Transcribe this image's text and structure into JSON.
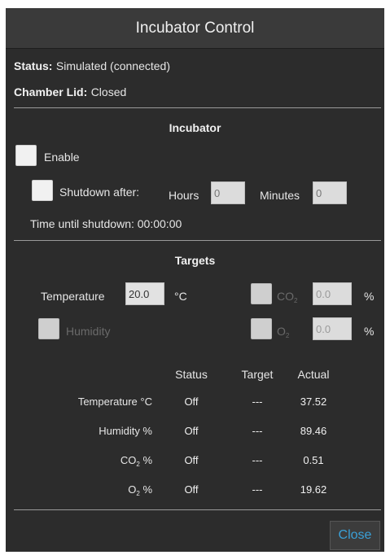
{
  "window": {
    "title": "Incubator Control"
  },
  "status": {
    "label": "Status:",
    "value": "Simulated (connected)"
  },
  "lid": {
    "label": "Chamber Lid:",
    "value": "Closed"
  },
  "incubator": {
    "section_title": "Incubator",
    "enable_label": "Enable",
    "shutdown_label": "Shutdown after:",
    "hours_label": "Hours",
    "hours_value": "0",
    "minutes_label": "Minutes",
    "minutes_value": "0",
    "time_until_label": "Time until shutdown:",
    "time_until_value": "00:00:00"
  },
  "targets": {
    "section_title": "Targets",
    "temperature_label": "Temperature",
    "temperature_value": "20.0",
    "temperature_unit": "°C",
    "humidity_label": "Humidity",
    "co2_prefix": "CO",
    "co2_sub": "2",
    "co2_value": "0.0",
    "co2_unit": "%",
    "o2_prefix": "O",
    "o2_sub": "2",
    "o2_value": "0.0",
    "o2_unit": "%"
  },
  "table": {
    "headers": [
      "Status",
      "Target",
      "Actual"
    ],
    "rows": [
      {
        "label": "Temperature °C",
        "status": "Off",
        "target": "---",
        "actual": "37.52"
      },
      {
        "label": "Humidity %",
        "status": "Off",
        "target": "---",
        "actual": "89.46"
      },
      {
        "label_prefix": "CO",
        "label_sub": "2",
        "label_suffix": " %",
        "status": "Off",
        "target": "---",
        "actual": "0.51"
      },
      {
        "label_prefix": "O",
        "label_sub": "2",
        "label_suffix": " %",
        "status": "Off",
        "target": "---",
        "actual": "19.62"
      }
    ]
  },
  "footer": {
    "close_label": "Close"
  },
  "colors": {
    "accent": "#3aa0d8",
    "background": "#2c2c2c"
  }
}
